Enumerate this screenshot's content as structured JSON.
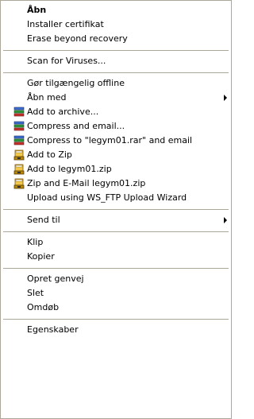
{
  "menu": {
    "items": [
      {
        "label": "Åbn"
      },
      {
        "label": "Installer certifikat"
      },
      {
        "label": "Erase beyond recovery"
      },
      {
        "label": "Scan for Viruses..."
      },
      {
        "label": "Gør tilgængelig offline"
      },
      {
        "label": "Åbn med"
      },
      {
        "label": "Add to archive...",
        "icon": "winrar-books-icon"
      },
      {
        "label": "Compress and email...",
        "icon": "winrar-books-icon"
      },
      {
        "label": "Compress to \"legym01.rar\" and email",
        "icon": "winrar-books-icon"
      },
      {
        "label": "Add to Zip",
        "icon": "winzip-vise-icon"
      },
      {
        "label": "Add to legym01.zip",
        "icon": "winzip-vise-icon"
      },
      {
        "label": "Zip and E-Mail legym01.zip",
        "icon": "winzip-vise-icon"
      },
      {
        "label": "Upload using WS_FTP Upload Wizard"
      },
      {
        "label": "Send til"
      },
      {
        "label": "Klip"
      },
      {
        "label": "Kopier"
      },
      {
        "label": "Opret genvej"
      },
      {
        "label": "Slet"
      },
      {
        "label": "Omdøb"
      },
      {
        "label": "Egenskaber"
      }
    ],
    "submenu_arrow_icon": "submenu-arrow-icon"
  },
  "colors": {
    "background": "#ffffff",
    "text": "#000000",
    "border": "#aca899",
    "separator": "#aca899"
  }
}
